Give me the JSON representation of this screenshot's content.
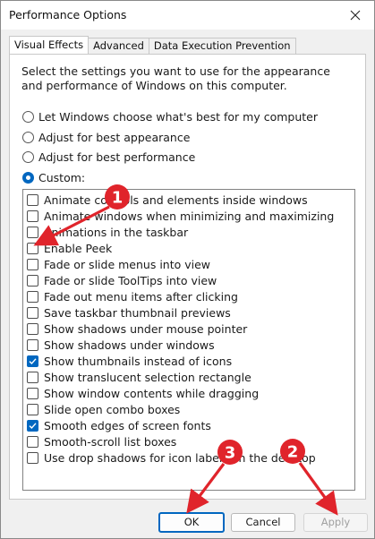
{
  "window": {
    "title": "Performance Options"
  },
  "tabs": [
    {
      "label": "Visual Effects",
      "active": true
    },
    {
      "label": "Advanced",
      "active": false
    },
    {
      "label": "Data Execution Prevention",
      "active": false
    }
  ],
  "visual_effects": {
    "description": "Select the settings you want to use for the appearance and performance of Windows on this computer.",
    "radio_options": [
      {
        "label": "Let Windows choose what's best for my computer",
        "checked": false
      },
      {
        "label": "Adjust for best appearance",
        "checked": false
      },
      {
        "label": "Adjust for best performance",
        "checked": false
      },
      {
        "label": "Custom:",
        "checked": true
      }
    ],
    "effects": [
      {
        "label": "Animate controls and elements inside windows",
        "checked": false
      },
      {
        "label": "Animate windows when minimizing and maximizing",
        "checked": false
      },
      {
        "label": "Animations in the taskbar",
        "checked": false
      },
      {
        "label": "Enable Peek",
        "checked": false
      },
      {
        "label": "Fade or slide menus into view",
        "checked": false
      },
      {
        "label": "Fade or slide ToolTips into view",
        "checked": false
      },
      {
        "label": "Fade out menu items after clicking",
        "checked": false
      },
      {
        "label": "Save taskbar thumbnail previews",
        "checked": false
      },
      {
        "label": "Show shadows under mouse pointer",
        "checked": false
      },
      {
        "label": "Show shadows under windows",
        "checked": false
      },
      {
        "label": "Show thumbnails instead of icons",
        "checked": true
      },
      {
        "label": "Show translucent selection rectangle",
        "checked": false
      },
      {
        "label": "Show window contents while dragging",
        "checked": false
      },
      {
        "label": "Slide open combo boxes",
        "checked": false
      },
      {
        "label": "Smooth edges of screen fonts",
        "checked": true
      },
      {
        "label": "Smooth-scroll list boxes",
        "checked": false
      },
      {
        "label": "Use drop shadows for icon labels on the desktop",
        "checked": false
      }
    ]
  },
  "buttons": {
    "ok": "OK",
    "cancel": "Cancel",
    "apply": "Apply"
  },
  "annotations": [
    {
      "number": "1",
      "color": "#e0242b"
    },
    {
      "number": "2",
      "color": "#e0242b"
    },
    {
      "number": "3",
      "color": "#e0242b"
    }
  ],
  "colors": {
    "accent": "#0067c0",
    "annotation": "#e0242b"
  }
}
